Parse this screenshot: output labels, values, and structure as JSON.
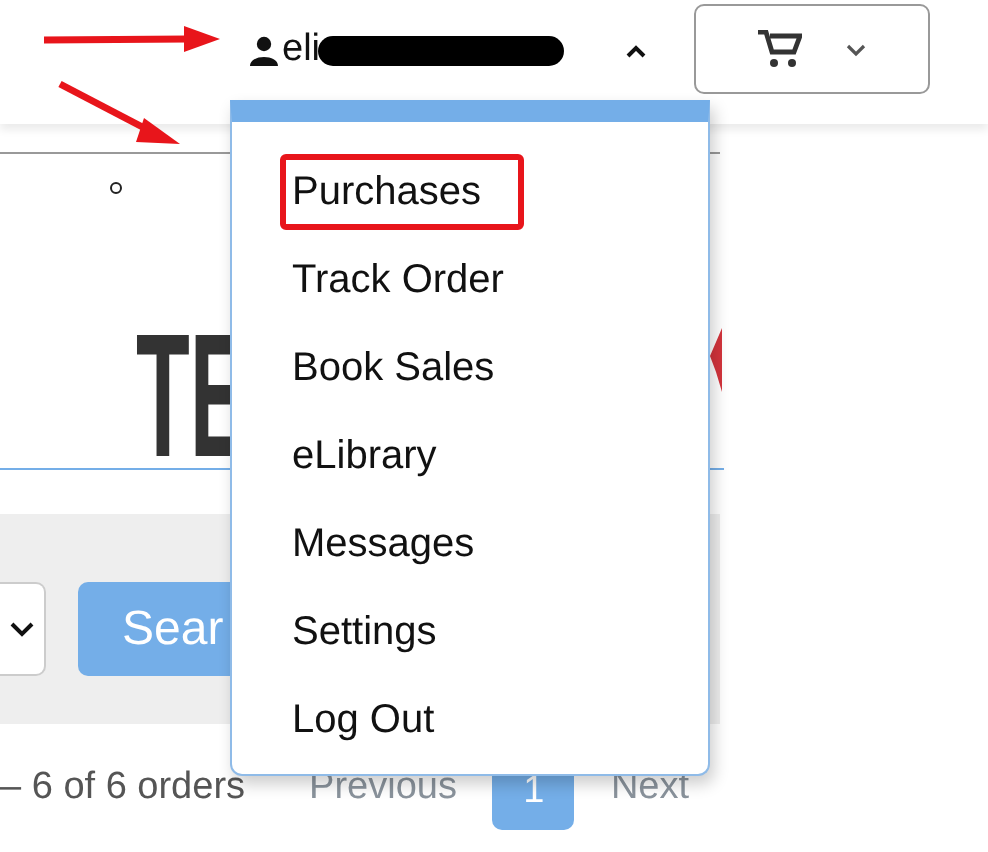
{
  "user_menu": {
    "username": "eli",
    "expanded": true,
    "items": [
      {
        "label": "Purchases",
        "annotated": true
      },
      {
        "label": "Track Order",
        "annotated": false
      },
      {
        "label": "Book Sales",
        "annotated": false
      },
      {
        "label": "eLibrary",
        "annotated": false
      },
      {
        "label": "Messages",
        "annotated": false
      },
      {
        "label": "Settings",
        "annotated": false
      },
      {
        "label": "Log Out",
        "annotated": false
      }
    ]
  },
  "logo": {
    "text_1": "TE"
  },
  "search": {
    "button": "Sear"
  },
  "pagination": {
    "summary": "– 6 of 6 orders",
    "previous": "Previous",
    "pages": [
      {
        "label": "1",
        "selected": true
      }
    ],
    "next": "Next"
  },
  "annotations": [
    {
      "kind": "arrow"
    },
    {
      "kind": "arrow"
    }
  ]
}
